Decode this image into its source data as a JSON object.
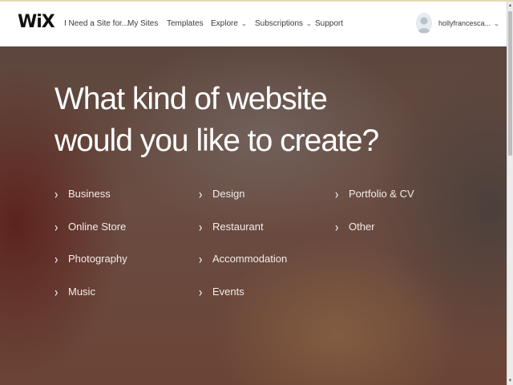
{
  "header": {
    "logo": "WiX",
    "nav": [
      {
        "label": "I Need a Site for...",
        "dropdown": false
      },
      {
        "label": "My Sites",
        "dropdown": false
      },
      {
        "label": "Templates",
        "dropdown": false
      },
      {
        "label": "Explore",
        "dropdown": true
      },
      {
        "label": "Subscriptions",
        "dropdown": true
      },
      {
        "label": "Support",
        "dropdown": false
      }
    ],
    "user": {
      "name": "hollyfrancesca...",
      "icon": "user-avatar-icon"
    }
  },
  "hero": {
    "title_line1": "What kind of website",
    "title_line2": "would you like to create?",
    "options": {
      "business": "Business",
      "online_store": "Online Store",
      "photography": "Photography",
      "music": "Music",
      "design": "Design",
      "restaurant": "Restaurant",
      "accommodation": "Accommodation",
      "events": "Events",
      "portfolio_cv": "Portfolio & CV",
      "other": "Other"
    },
    "arrow_glyph": "›"
  },
  "colors": {
    "accent_text": "#ffffff",
    "header_bg": "#ffffff",
    "hero_base": "#6a4c42"
  }
}
